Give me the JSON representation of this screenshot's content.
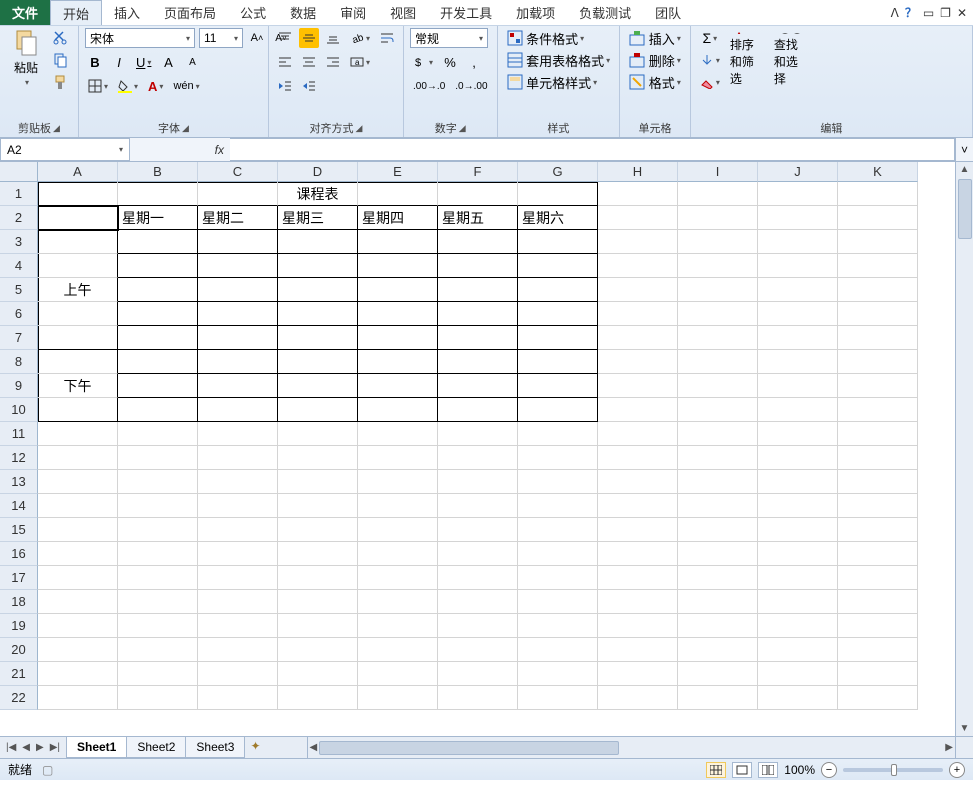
{
  "tabs": {
    "file": "文件",
    "items": [
      "开始",
      "插入",
      "页面布局",
      "公式",
      "数据",
      "审阅",
      "视图",
      "开发工具",
      "加载项",
      "负载测试",
      "团队"
    ],
    "active": 0
  },
  "ribbon": {
    "clipboard": {
      "label": "剪贴板",
      "paste": "粘贴"
    },
    "font": {
      "label": "字体",
      "name": "宋体",
      "size": "11"
    },
    "align": {
      "label": "对齐方式"
    },
    "number": {
      "label": "数字",
      "format": "常规"
    },
    "styles": {
      "label": "样式",
      "cond": "条件格式",
      "tablefmt": "套用表格格式",
      "cellstyle": "单元格样式"
    },
    "cells": {
      "label": "单元格",
      "insert": "插入",
      "delete": "删除",
      "format": "格式"
    },
    "editing": {
      "label": "编辑",
      "sort": "排序和筛选",
      "find": "查找和选择"
    }
  },
  "namebox": "A2",
  "columns": [
    "A",
    "B",
    "C",
    "D",
    "E",
    "F",
    "G",
    "H",
    "I",
    "J",
    "K"
  ],
  "rows": [
    "1",
    "2",
    "3",
    "4",
    "5",
    "6",
    "7",
    "8",
    "9",
    "10",
    "11",
    "12",
    "13",
    "14",
    "15",
    "16",
    "17",
    "18",
    "19",
    "20",
    "21",
    "22"
  ],
  "cells": {
    "title": "课程表",
    "days": [
      "星期一",
      "星期二",
      "星期三",
      "星期四",
      "星期五",
      "星期六"
    ],
    "am": "上午",
    "pm": "下午"
  },
  "sheets": {
    "items": [
      "Sheet1",
      "Sheet2",
      "Sheet3"
    ],
    "active": 0
  },
  "status": {
    "ready": "就绪",
    "zoom": "100%"
  }
}
